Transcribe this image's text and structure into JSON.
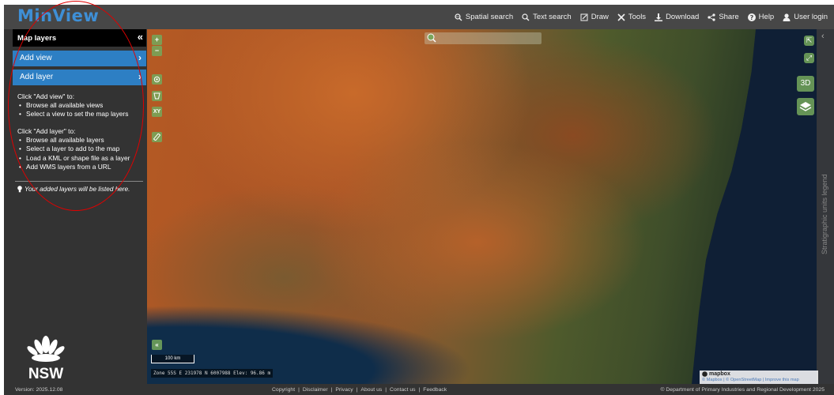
{
  "app": {
    "logo": "MinView"
  },
  "nav": [
    {
      "label": "Spatial search",
      "icon": "magnify-globe-icon"
    },
    {
      "label": "Text search",
      "icon": "search-icon"
    },
    {
      "label": "Draw",
      "icon": "draw-icon"
    },
    {
      "label": "Tools",
      "icon": "tools-icon"
    },
    {
      "label": "Download",
      "icon": "download-icon"
    },
    {
      "label": "Share",
      "icon": "share-icon"
    },
    {
      "label": "Help",
      "icon": "help-icon"
    },
    {
      "label": "User login",
      "icon": "user-icon"
    }
  ],
  "sidebar": {
    "title": "Map layers",
    "collapse": "«",
    "add_view": "Add view",
    "add_layer": "Add layer",
    "view_help_title": "Click \"Add view\" to:",
    "view_help_items": [
      "Browse all available views",
      "Select a view to set the map layers"
    ],
    "layer_help_title": "Click \"Add layer\" to:",
    "layer_help_items": [
      "Browse all available layers",
      "Select a layer to add to the map",
      "Load a KML or shape file as a layer",
      "Add WMS layers from a URL"
    ],
    "added_note": "Your added layers will be listed here.",
    "brand": "NSW"
  },
  "map": {
    "zoom_in": "+",
    "zoom_out": "−",
    "xy_label": "XY",
    "mode_3d": "3D",
    "legend_label": "Stratigraphic units legend",
    "legend_chevron": "‹",
    "scale": "100 km",
    "coords": "Zone 55S E 231978 N 6007988 Elev: 96.86 m",
    "expand_bottom": "«",
    "attribution_logo": "mapbox",
    "attribution_links": "© Mapbox | © OpenStreetMap | Improve this map"
  },
  "footer": {
    "version": "Version: 2025.12.08",
    "links": [
      "Copyright",
      "Disclaimer",
      "Privacy",
      "About us",
      "Contact us",
      "Feedback"
    ],
    "separator": "|",
    "copyright": "© Department of Primary Industries and Regional Development 2025"
  },
  "colors": {
    "accent": "#2d7fc4",
    "logo": "#3e8fd6",
    "map_control": "#74a85c",
    "annotation": "#e10000"
  }
}
